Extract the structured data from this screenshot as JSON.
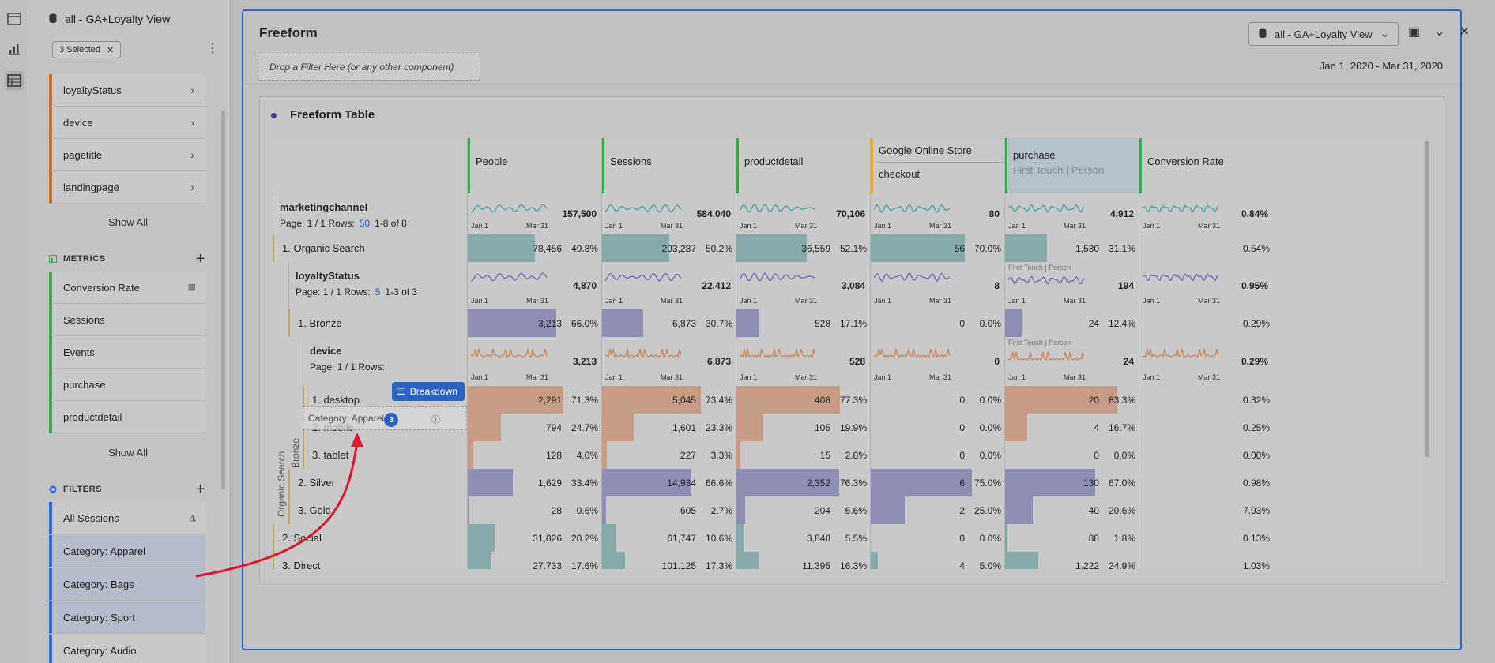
{
  "rail": {
    "icons": [
      "panel-icon",
      "chart-icon",
      "components-icon"
    ]
  },
  "panel": {
    "title": "all - GA+Loyalty View",
    "selected_pill": "3 Selected",
    "dimensions": [
      "loyaltyStatus",
      "device",
      "pagetitle",
      "landingpage"
    ],
    "show_all": "Show All",
    "metrics_header": "METRICS",
    "metrics": [
      "Conversion Rate",
      "Sessions",
      "Events",
      "purchase",
      "productdetail"
    ],
    "filters_header": "FILTERS",
    "filters": [
      "All Sessions",
      "Category: Apparel",
      "Category: Bags",
      "Category: Sport",
      "Category: Audio"
    ],
    "colors": {
      "dimension": "#d46a1f",
      "metric": "#3aa84c",
      "filter": "#2b6bd9"
    }
  },
  "workspace": {
    "title": "Freeform",
    "report_suite": "all - GA+Loyalty View",
    "drop_filter": "Drop a Filter Here (or any other component)",
    "date_range": "Jan 1, 2020 - Mar 31, 2020",
    "table_title": "Freeform Table",
    "accent": "#2b62c8"
  },
  "table": {
    "columns": [
      {
        "label": "People"
      },
      {
        "label": "Sessions"
      },
      {
        "label": "productdetail"
      },
      {
        "label": "Google Online Store",
        "sub": "checkout"
      },
      {
        "label": "purchase",
        "sub": "First Touch | Person"
      },
      {
        "label": "Conversion Rate"
      }
    ],
    "spark_start": "Jan 1",
    "spark_end": "Mar 31",
    "first_touch_hint": "First Touch | Person",
    "marketingchannel": {
      "name": "marketingchannel",
      "page": "Page: 1 / 1 Rows:",
      "rows": "50",
      "range": "1-8 of 8",
      "totals": [
        "157,500",
        "584,040",
        "70,106",
        "80",
        "4,912",
        "0.84%"
      ]
    },
    "organic": {
      "label": "1. Organic Search",
      "values": [
        [
          "78,456",
          "49.8%"
        ],
        [
          "293,287",
          "50.2%"
        ],
        [
          "36,559",
          "52.1%"
        ],
        [
          "56",
          "70.0%"
        ],
        [
          "1,530",
          "31.1%"
        ],
        [
          "0.54%"
        ]
      ]
    },
    "loyalty": {
      "name": "loyaltyStatus",
      "page": "Page: 1 / 1 Rows:",
      "rows": "5",
      "range": "1-3 of 3",
      "totals": [
        "4,870",
        "22,412",
        "3,084",
        "8",
        "194",
        "0.95%"
      ]
    },
    "bronze": {
      "label": "1. Bronze",
      "values": [
        [
          "3,213",
          "66.0%"
        ],
        [
          "6,873",
          "30.7%"
        ],
        [
          "528",
          "17.1%"
        ],
        [
          "0",
          "0.0%"
        ],
        [
          "24",
          "12.4%"
        ],
        [
          "0.29%"
        ]
      ]
    },
    "device": {
      "name": "device",
      "page": "Page: 1 / 1 Rows:",
      "totals": [
        "3,213",
        "6,873",
        "528",
        "0",
        "24",
        "0.29%"
      ]
    },
    "device_rows": [
      {
        "label": "1. desktop",
        "values": [
          [
            "2,291",
            "71.3%"
          ],
          [
            "5,045",
            "73.4%"
          ],
          [
            "408",
            "77.3%"
          ],
          [
            "0",
            "0.0%"
          ],
          [
            "20",
            "83.3%"
          ],
          [
            "0.32%"
          ]
        ]
      },
      {
        "label": "2. mobile",
        "values": [
          [
            "794",
            "24.7%"
          ],
          [
            "1,601",
            "23.3%"
          ],
          [
            "105",
            "19.9%"
          ],
          [
            "0",
            "0.0%"
          ],
          [
            "4",
            "16.7%"
          ],
          [
            "0.25%"
          ]
        ]
      },
      {
        "label": "3. tablet",
        "values": [
          [
            "128",
            "4.0%"
          ],
          [
            "227",
            "3.3%"
          ],
          [
            "15",
            "2.8%"
          ],
          [
            "0",
            "0.0%"
          ],
          [
            "0",
            "0.0%"
          ],
          [
            "0.00%"
          ]
        ]
      }
    ],
    "loyalty_rows": [
      {
        "label": "2. Silver",
        "values": [
          [
            "1,629",
            "33.4%"
          ],
          [
            "14,934",
            "66.6%"
          ],
          [
            "2,352",
            "76.3%"
          ],
          [
            "6",
            "75.0%"
          ],
          [
            "130",
            "67.0%"
          ],
          [
            "0.98%"
          ]
        ]
      },
      {
        "label": "3. Gold",
        "values": [
          [
            "28",
            "0.6%"
          ],
          [
            "605",
            "2.7%"
          ],
          [
            "204",
            "6.6%"
          ],
          [
            "2",
            "25.0%"
          ],
          [
            "40",
            "20.6%"
          ],
          [
            "7.93%"
          ]
        ]
      }
    ],
    "channel_rows": [
      {
        "label": "2. Social",
        "values": [
          [
            "31,826",
            "20.2%"
          ],
          [
            "61,747",
            "10.6%"
          ],
          [
            "3,848",
            "5.5%"
          ],
          [
            "0",
            "0.0%"
          ],
          [
            "88",
            "1.8%"
          ],
          [
            "0.13%"
          ]
        ]
      },
      {
        "label": "3. Direct",
        "values": [
          [
            "27,733",
            "17.6%"
          ],
          [
            "101,125",
            "17.3%"
          ],
          [
            "11,395",
            "16.3%"
          ],
          [
            "4",
            "5.0%"
          ],
          [
            "1,222",
            "24.9%"
          ],
          [
            "1.03%"
          ]
        ]
      }
    ],
    "side_labels": [
      "Organic Search",
      "Bronze"
    ]
  },
  "drag": {
    "ghost_label": "Category: Apparel",
    "badge": "3",
    "breakdown": "Breakdown"
  }
}
